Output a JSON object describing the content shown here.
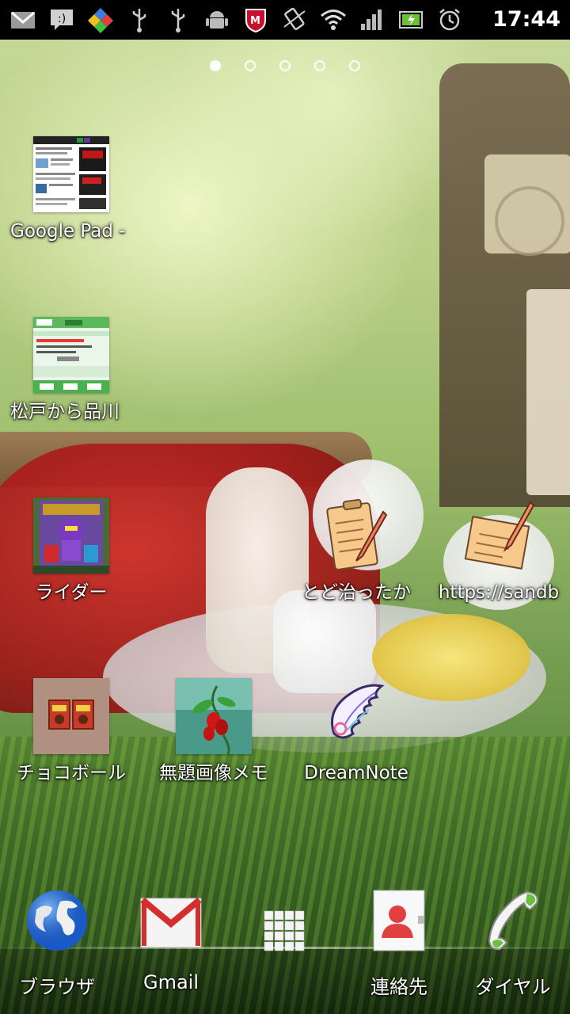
{
  "status_bar": {
    "icons": [
      "gmail-notification-icon",
      "talk-notification-icon",
      "colorful-app-icon",
      "usb-icon",
      "usb-icon",
      "android-debug-icon",
      "mcafee-icon",
      "rotation-lock-icon",
      "wifi-icon",
      "signal-icon",
      "battery-icon",
      "alarm-icon"
    ],
    "time": "17:44"
  },
  "page_indicator": {
    "total": 5,
    "active_index": 0
  },
  "shortcuts": [
    {
      "label": "Google Pad - ",
      "icon": "webpage-thumbnail"
    },
    {
      "label": "松戸から品川",
      "icon": "transit-thumbnail"
    },
    {
      "label": "ライダー",
      "icon": "rider-photo"
    },
    {
      "label": "とど治ったか",
      "icon": "memo-clipboard-icon"
    },
    {
      "label": "https://sandb",
      "icon": "memo-note-icon"
    },
    {
      "label": "チョコボール",
      "icon": "chocoball-photo"
    },
    {
      "label": "無題画像メモ",
      "icon": "berry-photo"
    },
    {
      "label": "DreamNote",
      "icon": "wing-icon"
    }
  ],
  "dock": [
    {
      "label": "ブラウザ",
      "icon": "globe-icon"
    },
    {
      "label": "Gmail",
      "icon": "gmail-icon"
    },
    {
      "label": "",
      "icon": "app-drawer-grid-icon"
    },
    {
      "label": "連絡先",
      "icon": "contacts-icon"
    },
    {
      "label": "ダイヤル",
      "icon": "phone-icon"
    }
  ]
}
